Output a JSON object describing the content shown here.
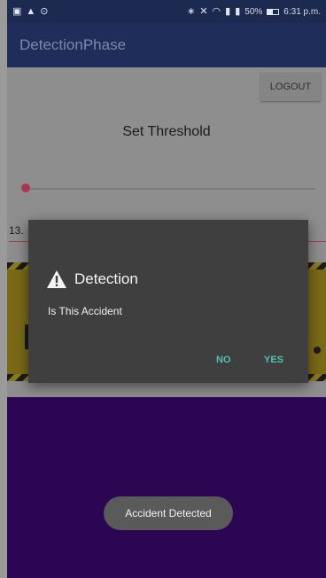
{
  "status_bar": {
    "battery_percent": "50%",
    "time": "6:31 p.m.",
    "left_icons": [
      "gallery-icon",
      "warning-icon",
      "circle-icon"
    ],
    "right_icons": [
      "bluetooth-icon",
      "mute-icon",
      "wifi-icon",
      "signal-icon",
      "signal-icon",
      "battery-icon"
    ]
  },
  "app_bar": {
    "title": "DetectionPhase"
  },
  "main": {
    "logout_label": "LOGOUT",
    "threshold_label": "Set Threshold",
    "input_value": "13.",
    "slider_value_fraction": 0.0
  },
  "dialog": {
    "title": "Detection",
    "message": "Is This Accident",
    "no_label": "NO",
    "yes_label": "YES"
  },
  "toast": {
    "text": "Accident Detected"
  },
  "colors": {
    "app_bar": "#1e2d5a",
    "accent": "#4fc2b3",
    "slider": "#a8384f",
    "purple_area": "#2a0653",
    "warning_band": "#7b6a17"
  }
}
